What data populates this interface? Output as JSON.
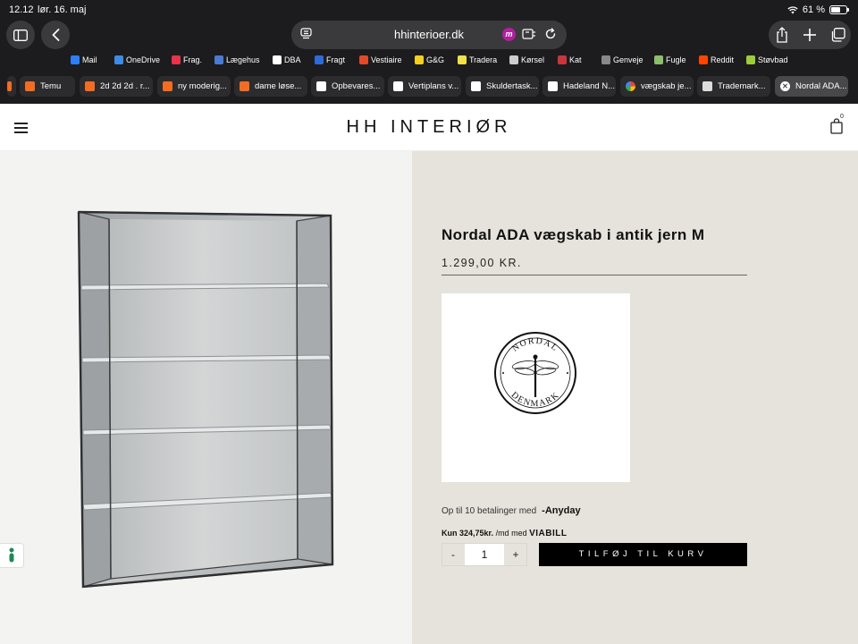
{
  "status": {
    "time": "12.12",
    "date": "lør. 16. maj",
    "battery": "61 %",
    "battery_level": 0.61
  },
  "browser": {
    "url": "hhinterioer.dk",
    "bookmarks": [
      {
        "label": "Mail",
        "icon": "mail-icon",
        "color": "#2d7ff9"
      },
      {
        "label": "OneDrive",
        "icon": "onedrive-icon",
        "color": "#3b8be8"
      },
      {
        "label": "Frag.",
        "icon": "frag-icon",
        "color": "#e8334a"
      },
      {
        "label": "Lægehus",
        "icon": "globe-icon",
        "color": "#4a7bd3"
      },
      {
        "label": "DBA",
        "icon": "dba-icon",
        "color": "#ffffff"
      },
      {
        "label": "Fragt",
        "icon": "dba-icon",
        "color": "#2e6bd8"
      },
      {
        "label": "Vestiaire",
        "icon": "vestiaire-icon",
        "color": "#e04a2b"
      },
      {
        "label": "G&G",
        "icon": "gg-icon",
        "color": "#f5d021"
      },
      {
        "label": "Tradera",
        "icon": "tradera-icon",
        "color": "#f0e04a"
      },
      {
        "label": "Kørsel",
        "icon": "korsel-icon",
        "color": "#cccccc"
      },
      {
        "label": "Kat",
        "icon": "paw-icon",
        "color": "#c8363c"
      },
      {
        "label": "Genveje",
        "icon": "apple-icon",
        "color": "#888888"
      },
      {
        "label": "Fugle",
        "icon": "bird-icon",
        "color": "#8bbf6a"
      },
      {
        "label": "Reddit",
        "icon": "reddit-icon",
        "color": "#ff4500"
      },
      {
        "label": "Støvbad",
        "icon": "stovbad-icon",
        "color": "#9ccc3a"
      }
    ],
    "tabs": [
      {
        "label": "Temu",
        "icon": "temu-icon",
        "color": "#f26d21"
      },
      {
        "label": "2d 2d 2d . r...",
        "icon": "temu-icon",
        "color": "#f26d21"
      },
      {
        "label": "ny moderig...",
        "icon": "temu-icon",
        "color": "#f26d21"
      },
      {
        "label": "dame løse...",
        "icon": "temu-icon",
        "color": "#f26d21"
      },
      {
        "label": "Opbevares...",
        "icon": "dba-icon",
        "color": "#ffffff"
      },
      {
        "label": "Vertiplans v...",
        "icon": "dba-icon",
        "color": "#ffffff"
      },
      {
        "label": "Skuldertask...",
        "icon": "dba-icon",
        "color": "#ffffff"
      },
      {
        "label": "Hadeland N...",
        "icon": "dba-icon",
        "color": "#ffffff"
      },
      {
        "label": "vægskab je...",
        "icon": "google-icon",
        "color": "#ffffff"
      },
      {
        "label": "Trademark...",
        "icon": "doc-icon",
        "color": "#dddddd"
      },
      {
        "label": "Nordal ADA...",
        "icon": "close-icon",
        "color": "#ffffff"
      }
    ]
  },
  "site": {
    "logo": "HH INTERIØR",
    "cart_count": "0"
  },
  "product": {
    "title": "Nordal ADA vægskab i antik jern M",
    "price": "1.299,00 KR.",
    "brand_top": "NORDAL",
    "brand_bottom": "DENMARK",
    "anyday_text": "Op til 10 betalinger med",
    "anyday_logo": "-Anyday",
    "vbill_amount": "Kun 324,75kr.",
    "vbill_text": "/md med",
    "vbill_logo": "VIABILL",
    "quantity": "1",
    "minus_label": "-",
    "plus_label": "+",
    "add_to_cart": "TILFØJ TIL KURV"
  },
  "colors": {
    "accent": "#000000",
    "right_panel": "#e6e3dc",
    "left_panel": "#f3f3f2"
  }
}
